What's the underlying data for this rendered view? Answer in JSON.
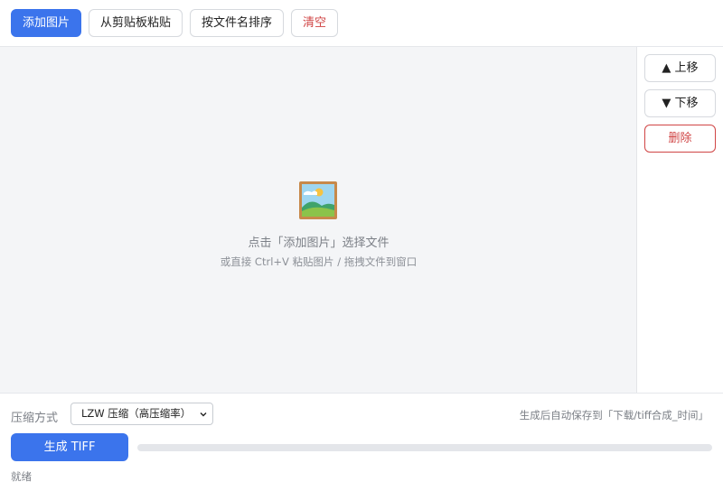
{
  "toolbar": {
    "add_images": "添加图片",
    "paste_clipboard": "从剪贴板粘贴",
    "sort_by_name": "按文件名排序",
    "clear": "清空"
  },
  "sidebar": {
    "move_up": "▲ 上移",
    "move_down": "▼ 下移",
    "delete": "删除"
  },
  "dropzone": {
    "icon": "framed-picture-icon",
    "hint_main": "点击「添加图片」选择文件",
    "hint_sub": "或直接 Ctrl+V 粘贴图片 / 拖拽文件到窗口"
  },
  "bottom": {
    "compress_label": "压缩方式",
    "compress_value": "LZW 压缩（高压缩率）",
    "save_note": "生成后自动保存到「下载/tiff合成_时间」",
    "generate_label": "生成 TIFF",
    "progress": 0,
    "status": "就绪"
  },
  "colors": {
    "primary": "#3b74ec",
    "danger": "#d04545",
    "dropzone_bg": "#f4f5f7"
  }
}
